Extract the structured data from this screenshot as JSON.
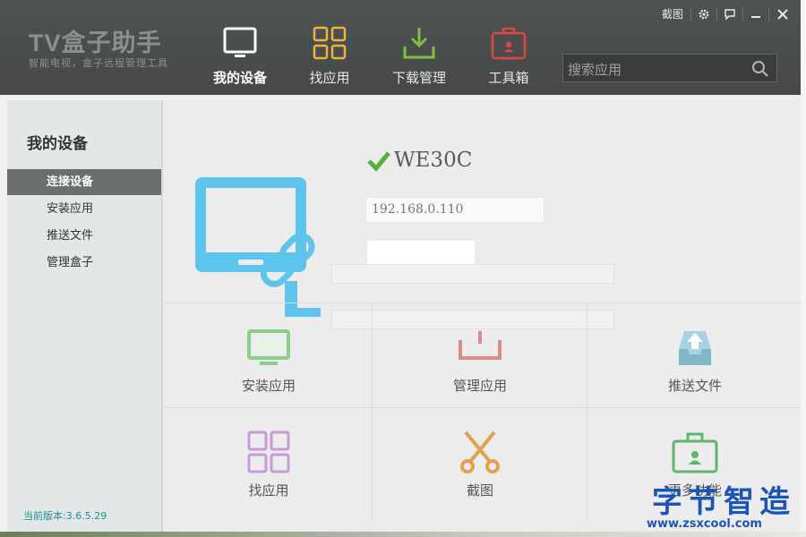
{
  "header": {
    "logo_title": "TV盒子助手",
    "logo_subtitle": "智能电视，盒子远程管理工具",
    "nav": [
      {
        "label": "我的设备",
        "icon": "tv-icon"
      },
      {
        "label": "找应用",
        "icon": "grid-icon"
      },
      {
        "label": "下载管理",
        "icon": "download-icon"
      },
      {
        "label": "工具箱",
        "icon": "toolbox-icon"
      }
    ],
    "window": {
      "screenshot_label": "截图"
    },
    "search_placeholder": "搜索应用"
  },
  "sidebar": {
    "title": "我的设备",
    "items": [
      {
        "label": "连接设备",
        "active": true
      },
      {
        "label": "安装应用"
      },
      {
        "label": "推送文件"
      },
      {
        "label": "管理盒子"
      }
    ],
    "version": "当前版本:3.6.5.29"
  },
  "device": {
    "name": "WE30C",
    "ip": "192.168.0.110"
  },
  "tiles": [
    {
      "label": "安装应用",
      "icon": "tv-install-icon",
      "color": "#8ccf8c"
    },
    {
      "label": "管理应用",
      "icon": "manage-app-icon",
      "color": "#d98c8c"
    },
    {
      "label": "推送文件",
      "icon": "push-file-icon",
      "color": "#7fb7c9"
    },
    {
      "label": "找应用",
      "icon": "grid-icon",
      "color": "#c79ad9"
    },
    {
      "label": "截图",
      "icon": "scissors-icon",
      "color": "#e0a24a"
    },
    {
      "label": "更多功能",
      "icon": "briefcase-icon",
      "color": "#5fb56a"
    }
  ],
  "watermark": {
    "text": "字节智造",
    "url": "www.zsxcool.com"
  }
}
